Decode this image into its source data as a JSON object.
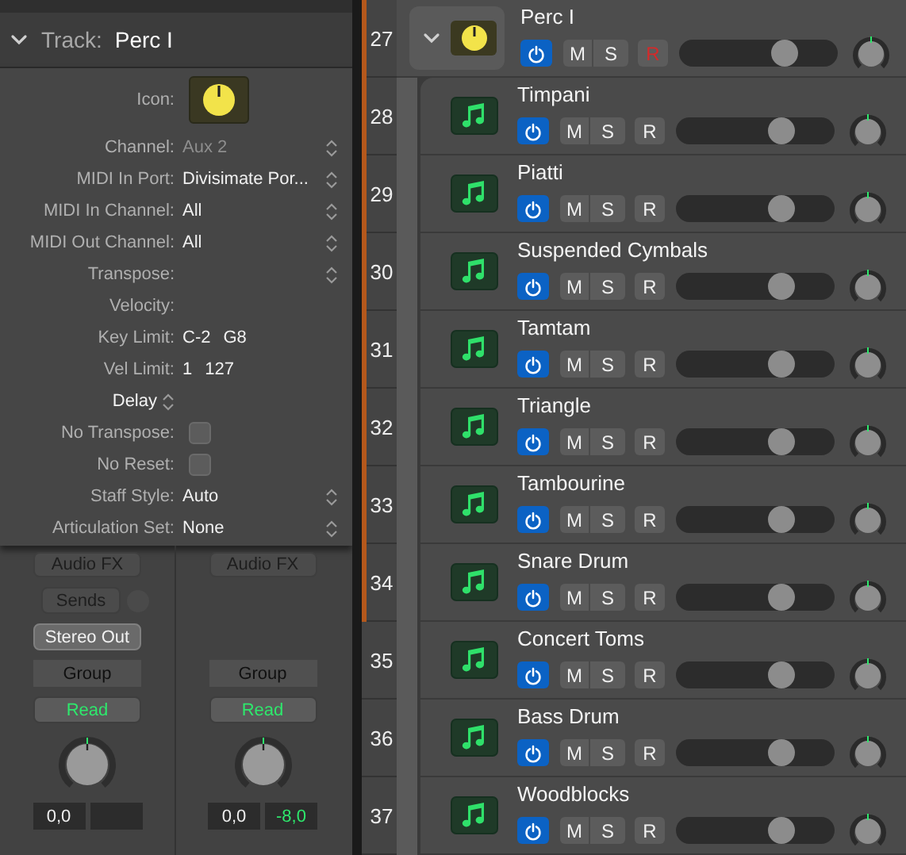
{
  "inspector": {
    "header": {
      "expanded": true,
      "label": "Track:",
      "value": "Perc I"
    },
    "rows": [
      {
        "kind": "icon",
        "label": "Icon:"
      },
      {
        "kind": "popup",
        "label": "Channel:",
        "value": "Aux 2",
        "disabled": true
      },
      {
        "kind": "popup",
        "label": "MIDI In Port:",
        "value": "Divisimate Por...",
        "disabled": false
      },
      {
        "kind": "popup",
        "label": "MIDI In Channel:",
        "value": "All",
        "disabled": false
      },
      {
        "kind": "popup",
        "label": "MIDI Out Channel:",
        "value": "All",
        "disabled": false
      },
      {
        "kind": "popup",
        "label": "Transpose:",
        "disabled": false
      },
      {
        "kind": "range",
        "label": "Velocity:"
      },
      {
        "kind": "range",
        "label": "Key Limit:",
        "values": [
          "C-2",
          "G8"
        ]
      },
      {
        "kind": "range",
        "label": "Vel Limit:",
        "values": [
          "1",
          "127"
        ]
      },
      {
        "kind": "stepper-label",
        "label": "Delay"
      },
      {
        "kind": "checkbox",
        "label": "No Transpose:",
        "checked": false
      },
      {
        "kind": "checkbox",
        "label": "No Reset:",
        "checked": false
      },
      {
        "kind": "popup",
        "label": "Staff Style:",
        "value": "Auto",
        "disabled": false
      },
      {
        "kind": "popup",
        "label": "Articulation Set:",
        "value": "None",
        "disabled": false
      }
    ]
  },
  "mixer": {
    "strips": [
      {
        "audio_fx": "Audio FX",
        "sends": "Sends",
        "output": "Stereo Out",
        "group": "Group",
        "automation": "Read",
        "readouts": [
          {
            "kind": "volume",
            "value": "0,0"
          },
          {
            "kind": "peak"
          }
        ]
      },
      {
        "audio_fx": "Audio FX",
        "group": "Group",
        "automation": "Read",
        "readouts": [
          {
            "kind": "volume",
            "value": "0,0"
          },
          {
            "kind": "peak",
            "value": "-8,0"
          }
        ]
      }
    ]
  },
  "tracks": [
    {
      "number": "27",
      "name": "Perc I",
      "kind": "folder",
      "expanded": true,
      "color": "#b5581c",
      "on": true,
      "mute_label": "M",
      "muted": false,
      "solo_label": "S",
      "soloed": false,
      "record_label": "R",
      "record": true,
      "level": 0.69
    },
    {
      "number": "28",
      "name": "Timpani",
      "kind": "instrument",
      "color": "#b5581c",
      "on": true,
      "mute_label": "M",
      "muted": false,
      "solo_label": "S",
      "soloed": false,
      "record_label": "R",
      "record": false,
      "level": 0.69
    },
    {
      "number": "29",
      "name": "Piatti",
      "kind": "instrument",
      "color": "#b5581c",
      "on": true,
      "mute_label": "M",
      "muted": false,
      "solo_label": "S",
      "soloed": false,
      "record_label": "R",
      "record": false,
      "level": 0.69
    },
    {
      "number": "30",
      "name": "Suspended Cymbals",
      "kind": "instrument",
      "color": "#b5581c",
      "on": true,
      "mute_label": "M",
      "muted": false,
      "solo_label": "S",
      "soloed": false,
      "record_label": "R",
      "record": false,
      "level": 0.69
    },
    {
      "number": "31",
      "name": "Tamtam",
      "kind": "instrument",
      "color": "#b5581c",
      "on": true,
      "mute_label": "M",
      "muted": false,
      "solo_label": "S",
      "soloed": false,
      "record_label": "R",
      "record": false,
      "level": 0.69
    },
    {
      "number": "32",
      "name": "Triangle",
      "kind": "instrument",
      "color": "#b5581c",
      "on": true,
      "mute_label": "M",
      "muted": false,
      "solo_label": "S",
      "soloed": false,
      "record_label": "R",
      "record": false,
      "level": 0.69
    },
    {
      "number": "33",
      "name": "Tambourine",
      "kind": "instrument",
      "color": "#b5581c",
      "on": true,
      "mute_label": "M",
      "muted": false,
      "solo_label": "S",
      "soloed": false,
      "record_label": "R",
      "record": false,
      "level": 0.69
    },
    {
      "number": "34",
      "name": "Snare Drum",
      "kind": "instrument",
      "color": "#b5581c",
      "on": true,
      "mute_label": "M",
      "muted": false,
      "solo_label": "S",
      "soloed": false,
      "record_label": "R",
      "record": false,
      "level": 0.69
    },
    {
      "number": "35",
      "name": "Concert Toms",
      "kind": "instrument",
      "on": true,
      "mute_label": "M",
      "muted": false,
      "solo_label": "S",
      "soloed": false,
      "record_label": "R",
      "record": false,
      "level": 0.69
    },
    {
      "number": "36",
      "name": "Bass Drum",
      "kind": "instrument",
      "on": true,
      "mute_label": "M",
      "muted": false,
      "solo_label": "S",
      "soloed": false,
      "record_label": "R",
      "record": false,
      "level": 0.69
    },
    {
      "number": "37",
      "name": "Woodblocks",
      "kind": "instrument",
      "on": true,
      "mute_label": "M",
      "muted": false,
      "solo_label": "S",
      "soloed": false,
      "record_label": "R",
      "record": false,
      "level": 0.69
    }
  ]
}
